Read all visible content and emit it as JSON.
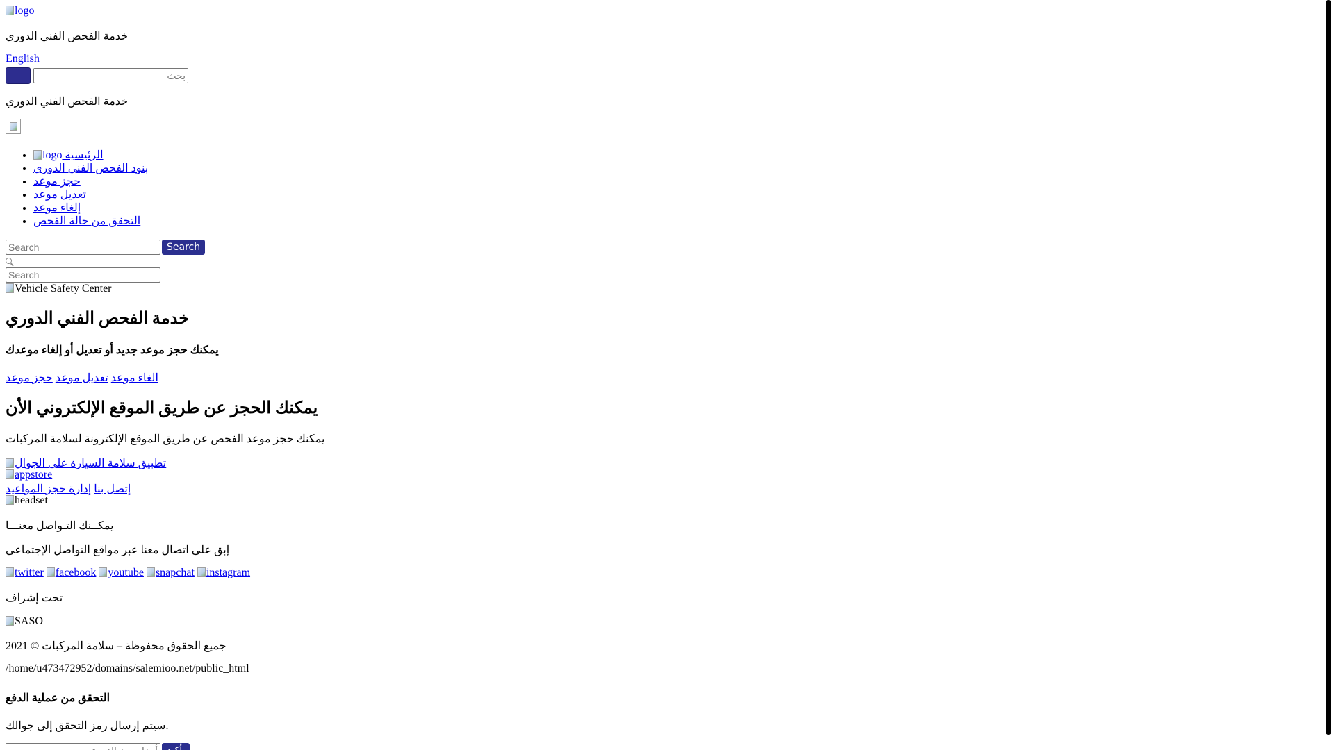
{
  "header": {
    "logo_alt": "logo",
    "site_title": "خدمة الفحص الفني الدوري",
    "language_link": "English",
    "search_placeholder": "بحث",
    "site_title_2": "خدمة الفحص الفني الدوري"
  },
  "nav": {
    "logo_alt": "logo",
    "items": [
      {
        "label": "الرئيسية"
      },
      {
        "label": "بنود الفحص الفني الدوري"
      },
      {
        "label": "حجز موعد"
      },
      {
        "label": "تعديل موعد"
      },
      {
        "label": "إلغاء موعد"
      },
      {
        "label": "التحقق من حالة الفحص"
      }
    ]
  },
  "search": {
    "placeholder": "Search",
    "button_label": "Search",
    "placeholder_2": "Search"
  },
  "hero": {
    "image_alt": "Vehicle Safety Center",
    "title": "خدمة الفحص الفني الدوري",
    "subtitle": "يمكنك حجز موعد جديد أو تعديل أو إلغاء موعدك",
    "links": {
      "book": "حجز موعد",
      "modify": "تعديل موعد",
      "cancel": "الغاء موعد"
    }
  },
  "online": {
    "title": "يمكنك الحجز عن طريق الموقع الإلكتروني الأن",
    "text": "يمكنك حجز موعد الفحص عن طريق الموقع الإلكترونة لسلامة المركبات",
    "mobile_app_alt": "تطبيق سلامة السيارة على الجوال",
    "appstore_alt": "appstore",
    "contact_link": "إتصل بنا",
    "manage_link": "إدارة حجز المواعيد"
  },
  "contact": {
    "headset_alt": "headset",
    "title": "يمكــنك التـواصل معنـــا",
    "text": "إبق على اتصال معنا عبر مواقع التواصل الإجتماعي",
    "social": {
      "twitter": "twitter",
      "facebook": "facebook",
      "youtube": "youtube",
      "snapchat": "snapchat",
      "instagram": "instagram"
    }
  },
  "footer": {
    "supervision": "تحت إشراف",
    "saso_alt": "SASO",
    "copyright": "2021 © جميع الحقوق محفوظة – سلامة المركبات",
    "path": "/home/u473472952/domains/salemioo.net/public_html"
  },
  "payment": {
    "title": "التحقق من عملية الدفع",
    "text": "سيتم إرسال رمز التحقق إلى جوالك.",
    "input_placeholder": "أدخل رمز التحقق",
    "button_label": "تأكيد"
  }
}
